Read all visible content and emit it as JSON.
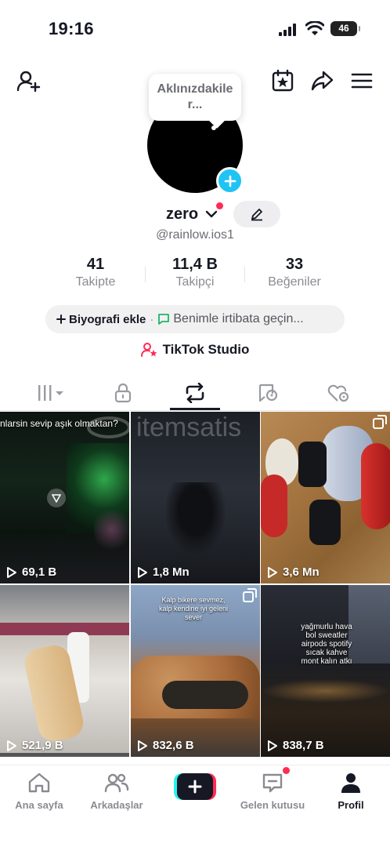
{
  "status_bar": {
    "time": "19:16",
    "battery": "46",
    "icons": [
      "signal-icon",
      "wifi-icon",
      "battery-icon"
    ]
  },
  "header": {
    "left_icon": "add-friend-icon",
    "right_icons": [
      "calendar-star-icon",
      "share-icon",
      "menu-icon"
    ]
  },
  "profile": {
    "bubble_text": "Aklınızdakiler...",
    "name": "zero",
    "handle": "@rainlow.ios1"
  },
  "stats": [
    {
      "value": "41",
      "label": "Takipte"
    },
    {
      "value": "11,4 B",
      "label": "Takipçi"
    },
    {
      "value": "33",
      "label": "Beğeniler"
    }
  ],
  "bio": {
    "add_label": "Biyografi ekle",
    "separator": "·",
    "contact_label": "Benimle irtibata geçin..."
  },
  "studio": {
    "label": "TikTok Studio"
  },
  "tabs": [
    "videos-grid-icon",
    "lock-icon",
    "repost-icon",
    "favorites-icon",
    "liked-icon"
  ],
  "active_tab": 2,
  "videos": [
    {
      "views": "69,1 B",
      "caption": "nlarsin sevip aşık olmaktan?"
    },
    {
      "views": "1,8 Mn",
      "caption": ""
    },
    {
      "views": "3,6 Mn",
      "caption": ""
    },
    {
      "views": "521,9 B",
      "caption": ""
    },
    {
      "views": "832,6 B",
      "caption": "Kalp bikere sevmez, kalp kendine iyi geleni sever"
    },
    {
      "views": "838,7 B",
      "caption": "yağmurlu hava bol sweatler airpods spotify sıcak kahve mont kalın atkı"
    }
  ],
  "watermark": "itemsatis",
  "nav": [
    {
      "label": "Ana sayfa",
      "icon": "home-icon"
    },
    {
      "label": "Arkadaşlar",
      "icon": "friends-icon"
    },
    {
      "label": "",
      "icon": "create-plus-icon"
    },
    {
      "label": "Gelen kutusu",
      "icon": "inbox-icon"
    },
    {
      "label": "Profil",
      "icon": "profile-icon"
    }
  ],
  "colors": {
    "accent_red": "#fe2c55",
    "accent_cyan": "#25f4ee",
    "avatar_plus": "#20c4f4",
    "text": "#161823",
    "muted": "#8a8b91"
  }
}
